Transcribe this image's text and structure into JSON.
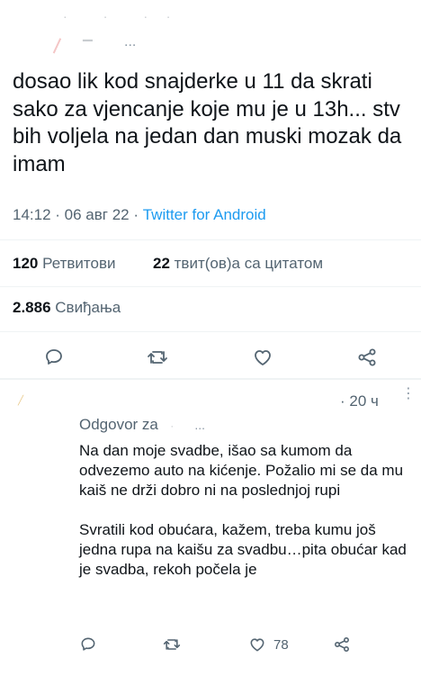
{
  "header": {
    "more_dots": "..."
  },
  "tweet": {
    "text": "dosao lik kod snajderke u 11 da skrati sako za vjencanje koje mu je u 13h... stv bih voljela na jedan dan muski mozak da imam",
    "time": "14:12 · 06 авг 22 · ",
    "source": "Twitter for Android"
  },
  "stats": {
    "retweets_count": "120",
    "retweets_label": " Ретвитови",
    "quotes_count": "22",
    "quotes_label": " твит(ов)а са цитатом",
    "likes_count": "2.886",
    "likes_label": " Свиђања"
  },
  "actions": {
    "icons": [
      "reply-icon",
      "retweet-icon",
      "like-icon",
      "share-icon"
    ]
  },
  "reply": {
    "time": "· 20 ч",
    "reply_to_label": "Odgovor za",
    "reply_to_dots": "...",
    "paragraph1": "Na dan moje svadbe, išao sa kumom da odvezemo auto na kićenje. Požalio mi se da mu kaiš ne drži dobro ni na poslednjoj rupi",
    "paragraph2": "Svratili kod obućara, kažem, treba kumu još jedna rupa na kaišu za svadbu…pita obućar kad je svadba, rekoh počela je",
    "like_count": "78"
  },
  "colors": {
    "accent": "#1d9bf0",
    "text": "#0f1419",
    "secondary": "#536471",
    "divider": "#eff3f4"
  }
}
